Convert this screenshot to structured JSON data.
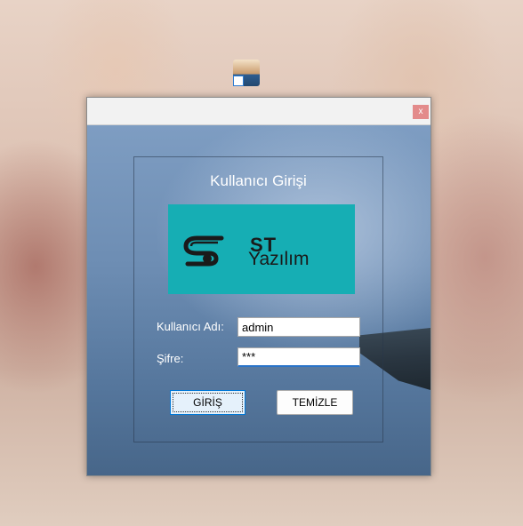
{
  "desktop": {
    "shortcut_icon": "user-shortcut-icon"
  },
  "window": {
    "close_label": "x",
    "title": "Kullanıcı Girişi",
    "logo": {
      "brand_short": "ST",
      "brand_name": "Yazılım",
      "background": "#16aeb4"
    },
    "form": {
      "username_label": "Kullanıcı Adı:",
      "username_value": "admin",
      "password_label": "Şifre:",
      "password_value": "***"
    },
    "buttons": {
      "login": "GİRİŞ",
      "clear": "TEMİZLE"
    }
  }
}
